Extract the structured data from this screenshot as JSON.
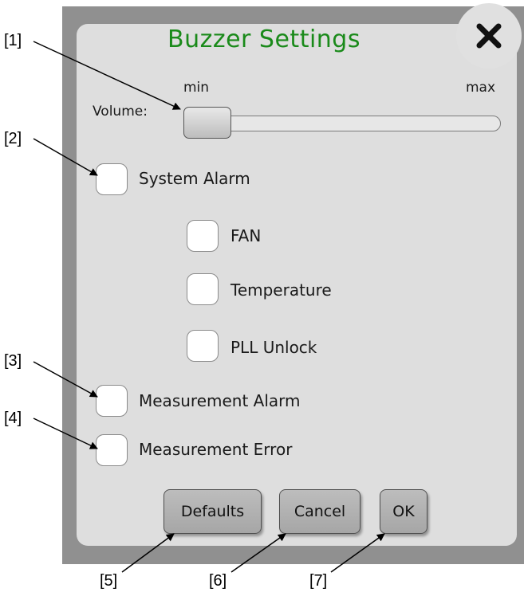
{
  "dialog": {
    "title": "Buzzer Settings",
    "close_icon": "close-x-icon"
  },
  "volume": {
    "label": "Volume:",
    "min_label": "min",
    "max_label": "max",
    "level": 0
  },
  "alarms": {
    "system_alarm": {
      "label": "System Alarm",
      "checked": false
    },
    "fan": {
      "label": "FAN",
      "checked": false
    },
    "temperature": {
      "label": "Temperature",
      "checked": false
    },
    "pll_unlock": {
      "label": "PLL Unlock",
      "checked": false
    },
    "measurement_alarm": {
      "label": "Measurement Alarm",
      "checked": false
    },
    "measurement_error": {
      "label": "Measurement Error",
      "checked": false
    }
  },
  "buttons": {
    "defaults": "Defaults",
    "cancel": "Cancel",
    "ok": "OK"
  },
  "callouts": [
    "[1]",
    "[2]",
    "[3]",
    "[4]",
    "[5]",
    "[6]",
    "[7]"
  ],
  "colors": {
    "title": "#1a8a1a",
    "frame": "#909090",
    "panel": "#dedede"
  }
}
